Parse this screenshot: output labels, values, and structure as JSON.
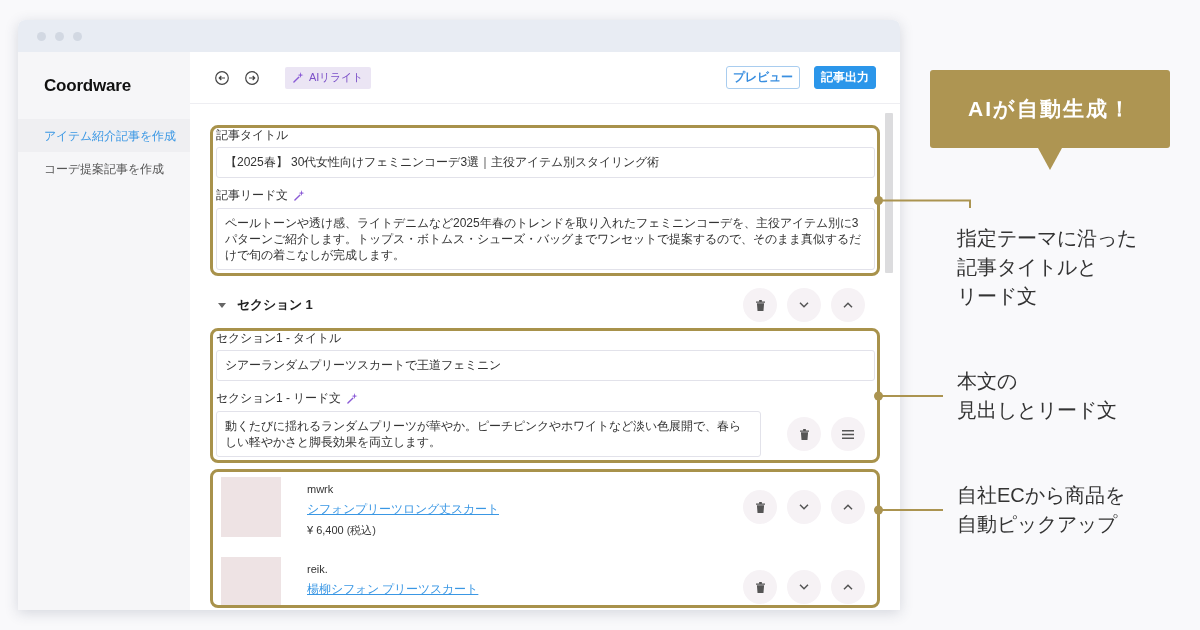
{
  "window": {
    "logo": "Coordware"
  },
  "sidebar": {
    "items": [
      {
        "label": "アイテム紹介記事を作成",
        "selected": true
      },
      {
        "label": "コーデ提案記事を作成",
        "selected": false
      }
    ]
  },
  "toolbar": {
    "ai_button": "AIリライト",
    "buttons": [
      {
        "label": "プレビュー",
        "kind": "outline"
      },
      {
        "label": "記事出力",
        "kind": "primary"
      }
    ]
  },
  "article": {
    "title_label": "記事タイトル",
    "title_value": "【2025春】 30代女性向けフェミニンコーデ3選｜主役アイテム別スタイリング術",
    "lead_label": "記事リード文",
    "lead_value": "ペールトーンや透け感、ライトデニムなど2025年春のトレンドを取り入れたフェミニンコーデを、主役アイテム別に3パターンご紹介します。トップス・ボトムス・シューズ・バッグまでワンセットで提案するので、そのまま真似するだけで旬の着こなしが完成します。"
  },
  "sections": [
    {
      "heading": "セクション 1",
      "expanded": true,
      "title_label": "セクション1 - タイトル",
      "title_value": "シアーランダムプリーツスカートで王道フェミニン",
      "lead_label": "セクション1 - リード文",
      "lead_value": "動くたびに揺れるランダムプリーツが華やか。ピーチピンクやホワイトなど淡い色展開で、春らしい軽やかさと脚長効果を両立します。",
      "products": [
        {
          "brand": "mwrk",
          "name": "シフォンプリーツロング丈スカート",
          "price": "¥ 6,400",
          "tax_note": "(税込)"
        },
        {
          "brand": "reik.",
          "name": "楊柳シフォン プリーツスカート"
        }
      ]
    }
  ],
  "annotations": {
    "callout": "AIが自動生成！",
    "notes": [
      {
        "lines": [
          "指定テーマに沿った",
          "記事タイトルと",
          "リード文"
        ]
      },
      {
        "lines": [
          "本文の",
          "見出しとリード文"
        ]
      },
      {
        "lines": [
          "自社ECから商品を",
          "自動ピックアップ"
        ]
      }
    ]
  }
}
